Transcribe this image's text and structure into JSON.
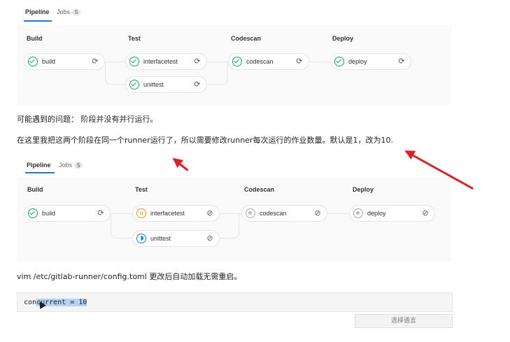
{
  "pipeline1": {
    "tabs": [
      {
        "label": "Pipeline"
      },
      {
        "label": "Jobs",
        "count": "5"
      }
    ],
    "stages": [
      {
        "title": "Build",
        "jobs": [
          {
            "name": "build",
            "status": "success"
          }
        ]
      },
      {
        "title": "Test",
        "jobs": [
          {
            "name": "interfacetest",
            "status": "success"
          },
          {
            "name": "unittest",
            "status": "success"
          }
        ]
      },
      {
        "title": "Codescan",
        "jobs": [
          {
            "name": "codescan",
            "status": "success"
          }
        ]
      },
      {
        "title": "Deploy",
        "jobs": [
          {
            "name": "deploy",
            "status": "success"
          }
        ]
      }
    ]
  },
  "text": {
    "p1": "可能遇到的问题： 阶段并没有并行运行。",
    "p2": "在这里我把这两个阶段在同一个runner运行了，所以需要修改runner每次运行的作业数量。默认是1，改为10.",
    "p3": "vim /etc/gitlab-runner/config.toml 更改后自动加载无需重启。"
  },
  "pipeline2": {
    "tabs": [
      {
        "label": "Pipeline"
      },
      {
        "label": "Jobs",
        "count": "5"
      }
    ],
    "stages": [
      {
        "title": "Build",
        "jobs": [
          {
            "name": "build",
            "status": "success"
          }
        ]
      },
      {
        "title": "Test",
        "jobs": [
          {
            "name": "interfacetest",
            "status": "paused"
          },
          {
            "name": "unittest",
            "status": "running"
          }
        ]
      },
      {
        "title": "Codescan",
        "jobs": [
          {
            "name": "codescan",
            "status": "created"
          }
        ]
      },
      {
        "title": "Deploy",
        "jobs": [
          {
            "name": "deploy",
            "status": "created"
          }
        ]
      }
    ]
  },
  "code": {
    "before": "con",
    "selected": "current = 10"
  },
  "lang_select": "选择语言",
  "colors": {
    "accent": "#1f78d1",
    "success": "#1aaa55",
    "paused": "#fc9403",
    "annotation": "#e02020"
  }
}
